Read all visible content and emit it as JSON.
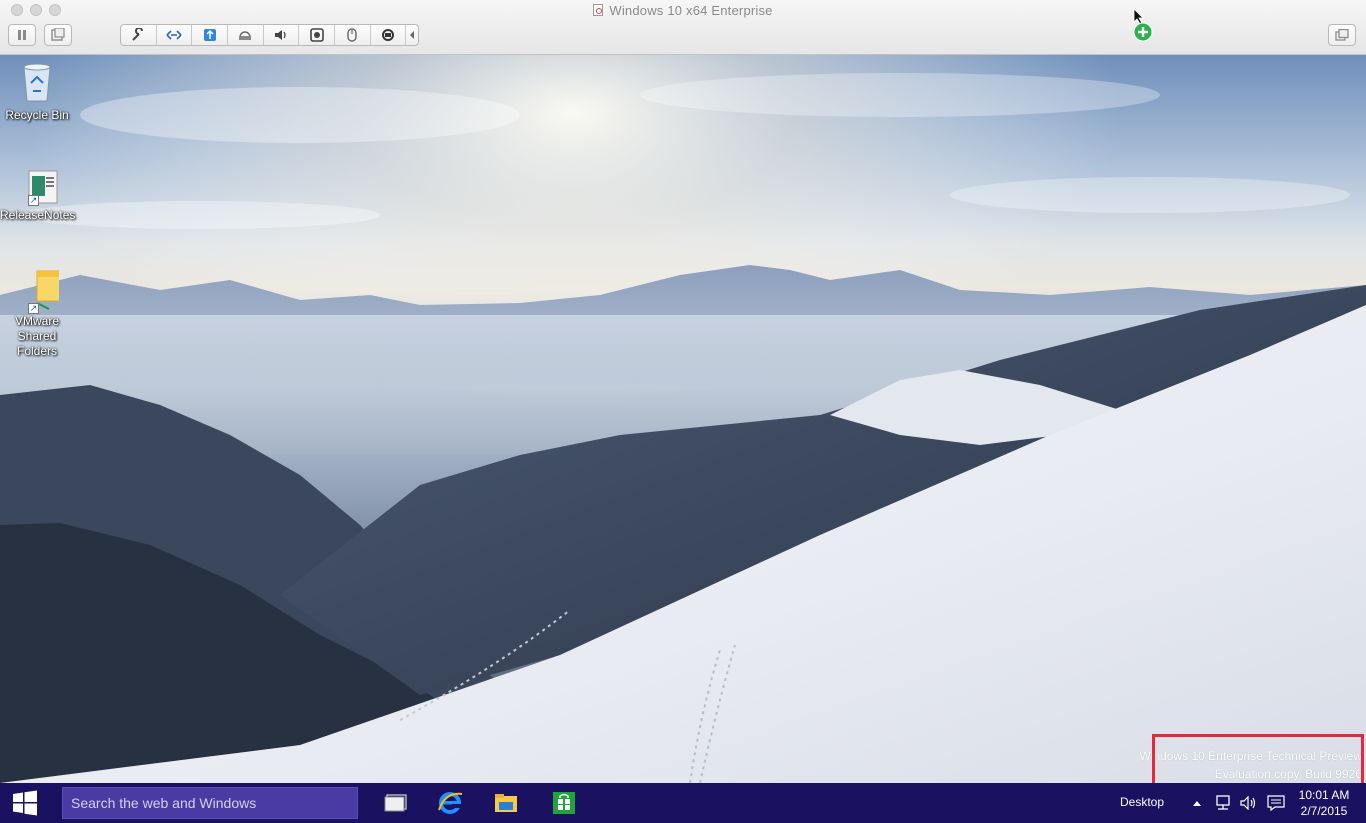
{
  "host_window": {
    "title": "Windows 10 x64 Enterprise",
    "toolbar_icons": [
      "wrench-icon",
      "network-icon",
      "usb-icon",
      "hdd-icon",
      "speaker-icon",
      "camera-icon",
      "mouse-icon",
      "settings-cycle-icon"
    ]
  },
  "desktop": {
    "icons": [
      {
        "label": "Recycle Bin"
      },
      {
        "label": "ReleaseNotes"
      },
      {
        "label": "VMware Shared Folders"
      }
    ],
    "watermark": {
      "line1": "Windows 10 Enterprise Technical Preview",
      "line2": "Evaluation copy. Build 9926"
    }
  },
  "taskbar": {
    "search_placeholder": "Search the web and Windows",
    "pinned": [
      "task-view",
      "internet-explorer",
      "file-explorer",
      "store"
    ],
    "desktop_label": "Desktop",
    "clock_time": "10:01 AM",
    "clock_date": "2/7/2015"
  },
  "colors": {
    "taskbar": "#1b1161",
    "search_box": "#4a3aa3",
    "highlight_box": "#e8283a",
    "add_badge": "#2bb24c"
  }
}
